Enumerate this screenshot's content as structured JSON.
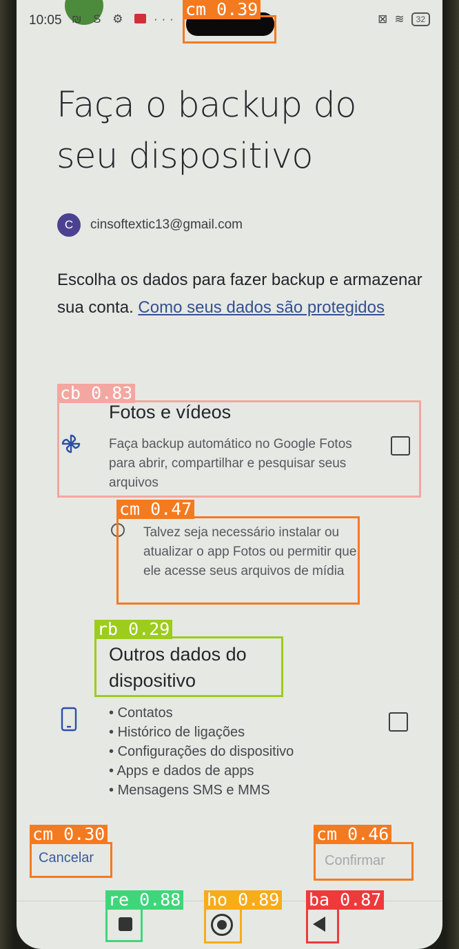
{
  "status_bar": {
    "time": "10:05",
    "left_icons": "₪ S ⚙",
    "more": "···",
    "battery": "32"
  },
  "page": {
    "title_line1": "Faça o backup do",
    "title_line2": "seu dispositivo",
    "account_initial": "C",
    "account_email": "cinsoftextic13@gmail.com",
    "description": "Escolha os dados para fazer backup e armazenar sua conta.",
    "privacy_link": "Como seus dados são protegidos"
  },
  "photos_option": {
    "title": "Fotos e vídeos",
    "description": "Faça backup automático no Google Fotos para abrir, compartilhar e pesquisar seus arquivos",
    "hint": "Talvez seja necessário instalar ou atualizar o app Fotos ou permitir que ele acesse seus arquivos de mídia",
    "checked": false
  },
  "device_option": {
    "title_line1": "Outros dados do",
    "title_line2": "dispositivo",
    "items": [
      "Contatos",
      "Histórico de ligações",
      "Configurações do dispositivo",
      "Apps e dados de apps",
      "Mensagens SMS e MMS"
    ],
    "checked": false
  },
  "actions": {
    "cancel": "Cancelar",
    "confirm": "Confirmar"
  },
  "colors": {
    "accent": "#35508f",
    "icon": "#2a4fa8"
  },
  "detections": [
    {
      "label": "cm 0.39",
      "color": "#f47a20"
    },
    {
      "label": "cb 0.83",
      "color": "#f4a6a0"
    },
    {
      "label": "cm 0.47",
      "color": "#f47a20"
    },
    {
      "label": "rb 0.29",
      "color": "#9ccc1c"
    },
    {
      "label": "cm 0.30",
      "color": "#f47a20"
    },
    {
      "label": "cm 0.46",
      "color": "#f47a20"
    },
    {
      "label": "re 0.88",
      "color": "#3fd67a"
    },
    {
      "label": "ho 0.89",
      "color": "#f8ac18"
    },
    {
      "label": "ba 0.87",
      "color": "#ee3a3a"
    }
  ]
}
